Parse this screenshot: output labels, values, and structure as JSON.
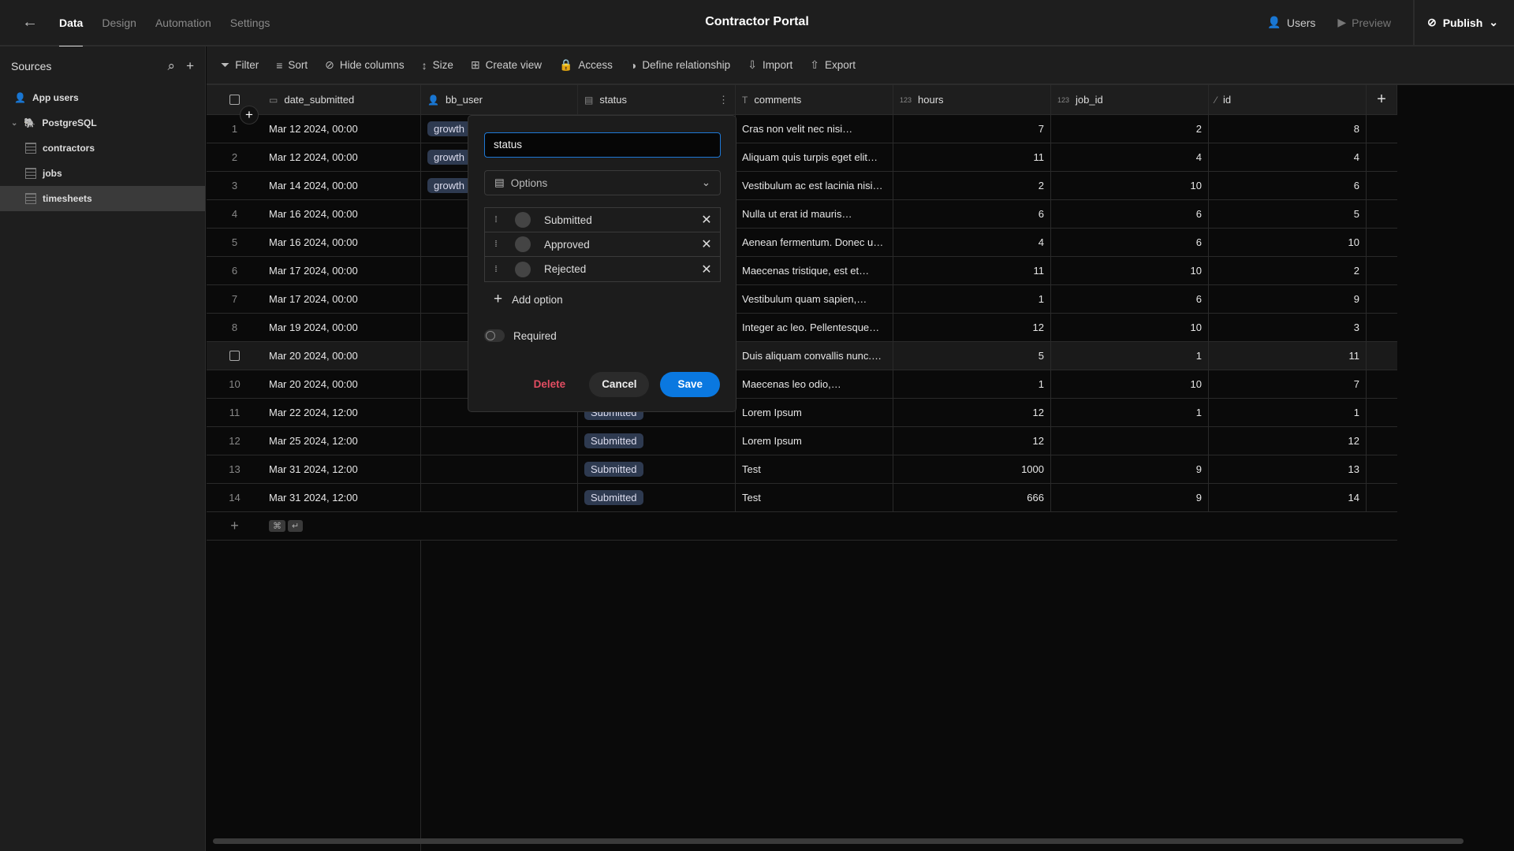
{
  "topbar": {
    "tabs": [
      {
        "label": "Data",
        "active": true
      },
      {
        "label": "Design"
      },
      {
        "label": "Automation"
      },
      {
        "label": "Settings"
      }
    ],
    "title": "Contractor Portal",
    "users": "Users",
    "preview": "Preview",
    "publish": "Publish"
  },
  "sidebar": {
    "title": "Sources",
    "items": [
      {
        "label": "App users",
        "icon": "user-icon"
      },
      {
        "label": "PostgreSQL",
        "icon": "postgresql-icon"
      },
      {
        "label": "contractors",
        "icon": "table-icon"
      },
      {
        "label": "jobs",
        "icon": "table-icon"
      },
      {
        "label": "timesheets",
        "icon": "table-icon",
        "selected": true
      }
    ]
  },
  "toolbar": {
    "filter": "Filter",
    "sort": "Sort",
    "hide_columns": "Hide columns",
    "size": "Size",
    "create_view": "Create view",
    "access": "Access",
    "define_relationship": "Define relationship",
    "import": "Import",
    "export": "Export"
  },
  "table": {
    "columns": [
      {
        "name": "date_submitted",
        "type": "date"
      },
      {
        "name": "bb_user",
        "type": "user"
      },
      {
        "name": "status",
        "type": "options"
      },
      {
        "name": "comments",
        "type": "text"
      },
      {
        "name": "hours",
        "type": "number",
        "prefix": "123"
      },
      {
        "name": "job_id",
        "type": "number",
        "prefix": "123"
      },
      {
        "name": "id",
        "type": "auto"
      }
    ],
    "rows": [
      {
        "n": "1",
        "date": "Mar 12 2024, 00:00",
        "user": "growth",
        "status": "",
        "comments": "Cras non velit nec nisi…",
        "hours": "7",
        "job_id": "2",
        "id": "8"
      },
      {
        "n": "2",
        "date": "Mar 12 2024, 00:00",
        "user": "growth",
        "status": "",
        "comments": "Aliquam quis turpis eget elit…",
        "hours": "11",
        "job_id": "4",
        "id": "4"
      },
      {
        "n": "3",
        "date": "Mar 14 2024, 00:00",
        "user": "growth",
        "status": "",
        "comments": "Vestibulum ac est lacinia nisi…",
        "hours": "2",
        "job_id": "10",
        "id": "6"
      },
      {
        "n": "4",
        "date": "Mar 16 2024, 00:00",
        "user": "",
        "status": "",
        "comments": "Nulla ut erat id mauris…",
        "hours": "6",
        "job_id": "6",
        "id": "5"
      },
      {
        "n": "5",
        "date": "Mar 16 2024, 00:00",
        "user": "",
        "status": "",
        "comments": "Aenean fermentum. Donec u…",
        "hours": "4",
        "job_id": "6",
        "id": "10"
      },
      {
        "n": "6",
        "date": "Mar 17 2024, 00:00",
        "user": "",
        "status": "",
        "comments": "Maecenas tristique, est et…",
        "hours": "11",
        "job_id": "10",
        "id": "2"
      },
      {
        "n": "7",
        "date": "Mar 17 2024, 00:00",
        "user": "",
        "status": "",
        "comments": "Vestibulum quam sapien,…",
        "hours": "1",
        "job_id": "6",
        "id": "9"
      },
      {
        "n": "8",
        "date": "Mar 19 2024, 00:00",
        "user": "",
        "status": "",
        "comments": "Integer ac leo. Pellentesque…",
        "hours": "12",
        "job_id": "10",
        "id": "3"
      },
      {
        "n": "",
        "date": "Mar 20 2024, 00:00",
        "user": "",
        "status": "",
        "comments": "Duis aliquam convallis nunc.…",
        "hours": "5",
        "job_id": "1",
        "id": "11",
        "hover": true
      },
      {
        "n": "10",
        "date": "Mar 20 2024, 00:00",
        "user": "",
        "status": "",
        "comments": "Maecenas leo odio,…",
        "hours": "1",
        "job_id": "10",
        "id": "7"
      },
      {
        "n": "11",
        "date": "Mar 22 2024, 12:00",
        "user": "",
        "status": "Submitted",
        "comments": "Lorem Ipsum",
        "hours": "12",
        "job_id": "1",
        "id": "1"
      },
      {
        "n": "12",
        "date": "Mar 25 2024, 12:00",
        "user": "",
        "status": "Submitted",
        "comments": "Lorem Ipsum",
        "hours": "12",
        "job_id": "",
        "id": "12"
      },
      {
        "n": "13",
        "date": "Mar 31 2024, 12:00",
        "user": "",
        "status": "Submitted",
        "comments": "Test",
        "hours": "1000",
        "job_id": "9",
        "id": "13"
      },
      {
        "n": "14",
        "date": "Mar 31 2024, 12:00",
        "user": "",
        "status": "Submitted",
        "comments": "Test",
        "hours": "666",
        "job_id": "9",
        "id": "14"
      }
    ],
    "add_row_keys": [
      "⌘",
      "↵"
    ]
  },
  "popover": {
    "name_value": "status",
    "type_label": "Options",
    "options": [
      "Submitted",
      "Approved",
      "Rejected"
    ],
    "add_option": "Add option",
    "required_label": "Required",
    "required": false,
    "delete": "Delete",
    "cancel": "Cancel",
    "save": "Save"
  },
  "colors": {
    "accent": "#0a78e0",
    "danger": "#e34d62",
    "tag": "#2e3a50"
  }
}
